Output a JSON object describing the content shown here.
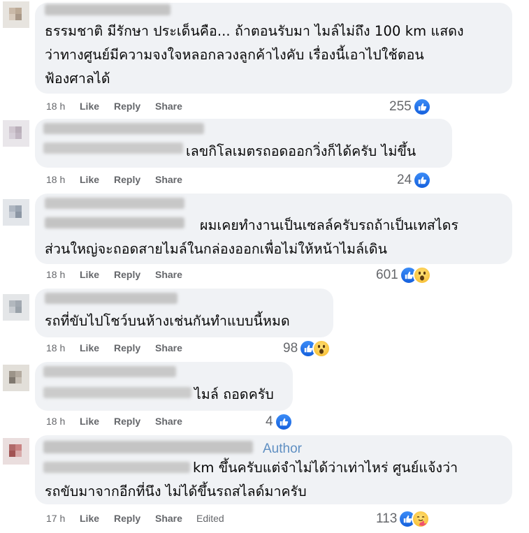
{
  "comments": [
    {
      "text": [
        "ธรรมชาติ มีรักษา ประเด็นคือ... ถ้าตอนรับมา ไมล์ไม่ถึง 100 km แสดง",
        "ว่าทางศูนย์มีความจงใจหลอกลวงลูกค้าไงคับ เรื่องนี้เอาไปใช้ตอน",
        "ฟ้องศาลได้"
      ],
      "time": "18 h",
      "like": "Like",
      "reply": "Reply",
      "share": "Share",
      "reaction_count": "255",
      "reactions": [
        "like-icon"
      ]
    },
    {
      "text": [
        "เลขกิโลเมตรถอดออกวิ่งก็ได้ครับ ไม่ขึ้น"
      ],
      "time": "18 h",
      "like": "Like",
      "reply": "Reply",
      "share": "Share",
      "reaction_count": "24",
      "reactions": [
        "like-icon"
      ]
    },
    {
      "text": [
        "ผมเคยทำงานเป็นเซลล์ครับรถถ้าเป็นเทสไดร",
        "ส่วนใหญ่จะถอดสายไมล์ในกล่องออกเพื่อไม่ให้หน้าไมล์เดิน"
      ],
      "time": "18 h",
      "like": "Like",
      "reply": "Reply",
      "share": "Share",
      "reaction_count": "601",
      "reactions": [
        "like-icon",
        "wow-icon"
      ]
    },
    {
      "text": [
        "รถที่ขับไปโชว์บนห้างเช่นกันทำแบบนี้หมด"
      ],
      "time": "18 h",
      "like": "Like",
      "reply": "Reply",
      "share": "Share",
      "reaction_count": "98",
      "reactions": [
        "like-icon",
        "wow-icon"
      ]
    },
    {
      "text": [
        "ไมล์ ถอดครับ"
      ],
      "time": "18 h",
      "like": "Like",
      "reply": "Reply",
      "share": "Share",
      "reaction_count": "4",
      "reactions": [
        "like-icon"
      ]
    },
    {
      "author_label": "Author",
      "text": [
        "km ขึ้นครับแต่จำไม่ได้ว่าเท่าไหร่ ศูนย์แจ้งว่า",
        "รถขับมาจากอีกที่นึง ไม่ได้ขึ้นรถสไลด์มาครับ"
      ],
      "time": "17 h",
      "like": "Like",
      "reply": "Reply",
      "share": "Share",
      "edited": "Edited",
      "reaction_count": "113",
      "reactions": [
        "like-icon",
        "care-icon"
      ]
    }
  ],
  "colors": {
    "bubble": "#f0f2f5",
    "meta_text": "#65676b",
    "author_tag": "#5f8fc2",
    "like_blue": "#1877f2",
    "emoji_yellow": "#f7b928"
  }
}
